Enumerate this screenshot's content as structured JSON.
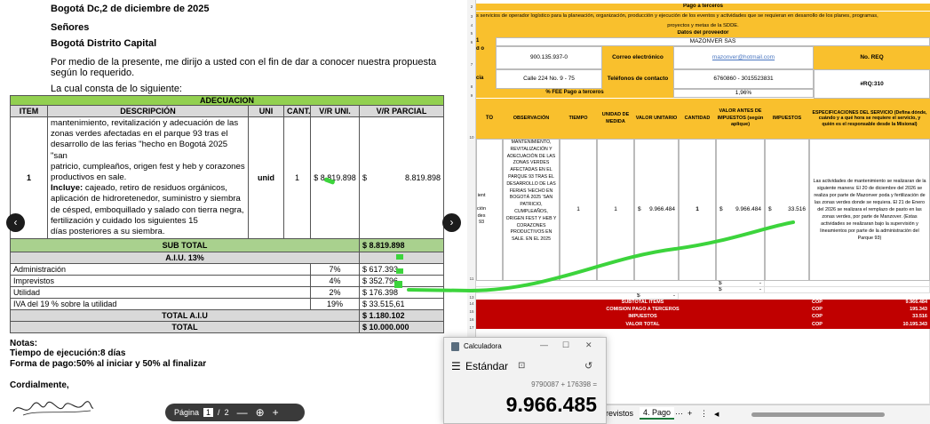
{
  "letter": {
    "date": "Bogotá Dc,2 de diciembre de 2025",
    "greeting": "Señores",
    "recipient": "Bogotá Distrito Capital",
    "intro1": "Por medio de la presente, me dirijo a usted con el fin de dar a conocer nuestra propuesta",
    "intro2": "según lo requerido.",
    "intro3": "La cual consta de lo siguiente:",
    "table_title": "ADECUACION",
    "headers": [
      "ITEM",
      "DESCRIPCIÓN",
      "UNI",
      "CANT.",
      "V/R UNI.",
      "V/R PARCIAL"
    ],
    "item": "1",
    "desc_lines": [
      "mantenimiento, revitalización y adecuación de las",
      "zonas verdes afectadas en el parque 93 tras el",
      "desarrollo de las ferias \"hecho en Bogotá 2025 \"san",
      "patricio, cumpleaños, origen fest y heb y corazones",
      "productivos en sale."
    ],
    "incluye_label": "Incluye:",
    "incluye_lines": [
      " cajeado, retiro de residuos orgánicos,",
      "aplicación de hidroretenedor, suministro y siembra",
      "de césped, emboquillado y salado con tierra negra,",
      "fertilización y cuidado los siguientes 15",
      "días posteriores a su siembra."
    ],
    "uni": "unid",
    "cant": "1",
    "vr_uni": "$ 8.819.898",
    "vr_parcial_sym": "$",
    "vr_parcial": "8.819.898",
    "subtotal_label": "SUB TOTAL",
    "subtotal": "$ 8.819.898",
    "aiu_label": "A.I.U. 13%",
    "aiu_rows": [
      {
        "label": "Administración",
        "pct": "7%",
        "val": "$ 617.393"
      },
      {
        "label": "Imprevistos",
        "pct": "4%",
        "val": "$ 352.796"
      },
      {
        "label": "Utilidad",
        "pct": "2%",
        "val": "$ 176.398"
      },
      {
        "label": "IVA del 19 % sobre la utilidad",
        "pct": "19%",
        "val": "$ 33.515,61"
      }
    ],
    "total_aiu_label": "TOTAL A.I.U",
    "total_aiu": "$ 1.180.102",
    "total_label": "TOTAL",
    "total": "$ 10.000.000",
    "notas": "Notas:",
    "tiempo": "Tiempo de ejecución:8 días",
    "pago": "Forma de pago:50% al iniciar y 50% al finalizar",
    "cordial": "Cordialmente,"
  },
  "pager": {
    "label": "Página",
    "page": "1",
    "sep": "/",
    "total": "2",
    "minus": "—",
    "zoom": "⊕",
    "plus": "+"
  },
  "nav": {
    "prev": "‹",
    "next": "›"
  },
  "sheet": {
    "rows": [
      "2",
      "3",
      "4",
      "5",
      "6",
      "7",
      "8",
      "9",
      "10",
      "11",
      "12",
      "13",
      "14",
      "15",
      "16",
      "17"
    ],
    "title": "Pago a terceros",
    "service_desc": "s servicios de operador logístico para la planeación, organización, producción y ejecución de los eventos y actividades  que se requieran en desarrollo de los planes, programas,",
    "service_desc2": "proyectos y metas de la SDDE.",
    "datos_prov": "Datos del proveedor",
    "r6_num": "1",
    "provider": "MAZONVER SAS",
    "nit_lbl": "d o",
    "nit": "900.135.937-0",
    "correo_lbl": "Correo electrónico",
    "correo": "mazonver@hotmail.com",
    "noreq_lbl": "No. REQ",
    "dir_lbl": "cia",
    "dir": "Calle 224 No. 9 - 75",
    "tel_lbl": "Teléfonos de contacto",
    "tel": "6760860 - 3015523831",
    "req": "#RQ:310",
    "fee_lbl": "% FEE Pago a terceros",
    "fee": "1,96%",
    "hdr_cols": [
      "TO",
      "OBSERVACIÓN",
      "TIEMPO",
      "UNIDAD DE MEDIDA",
      "VALOR UNITARIO",
      "CANTIDAD",
      "VALOR ANTES DE IMPUESTOS (según aplique)",
      "IMPUESTOS"
    ],
    "spec_hdr": "ESPECIFICACIONES DEL SERVICIO (Defina dónde, cuándo y a qué hora se requiere el servicio, y quién es el responsable desde la Misional)",
    "left_frag": "ient\n\nción\ndes\n93",
    "obs": "MANTENIMIENTO, REVITALIZACIÓN Y ADECUACIÓN DE LAS ZONAS VERDES AFECTADAS EN EL PARQUE 93 TRAS EL DESARROLLO DE LAS FERIAS 'HECHO EN BOGOTÁ 2025 'SAN PATRICIO, CUMPLEAÑOS, ORIGEN FEST Y HEB Y CORAZONES PRODUCTIVOS EN SALE. EN EL 2025",
    "tiempo": "1",
    "unidad": "1",
    "valor_sym": "$",
    "valor": "9.966.484",
    "cantidad": "1",
    "antes_sym": "$",
    "antes": "9.966.484",
    "imp_sym": "$",
    "imp": "33.516",
    "spec_text": "Las actividades de mantenimiento se realizaran de la siguiente manera: El 20 de diciembre del 2026 se realiza por parte de Mazonver poda y fertilización de las zonas verdes donde se requiera. El 21 de Enero del 2026 se realizara el remplazo de pasto en las zonas verdes, por parte de Manzover. (Estas actividades se realizaran bajo la supervisión y lineamientos por parte de la administración del Parque 93)",
    "dash_sym": "$",
    "dash": "-",
    "sum_labels": [
      "SUBTOTAL ÍTEMS",
      "COMISIÓN PAGO A TERCEROS",
      "IMPUESTOS",
      "VALOR TOTAL"
    ],
    "cop": "COP",
    "sum_vals": [
      "9.966.484",
      "195.343",
      "33.516",
      "10.195.343"
    ],
    "tab_prev": "Previstos",
    "tab_active": "4. Pago",
    "tab_more": "···",
    "tab_add": "+",
    "tab_menu": "⋮",
    "tab_arrow": "◀"
  },
  "calc": {
    "app": "Calculadora",
    "mode": "Estándar",
    "expr": "9790087 + 176398 =",
    "display": "9.966.485",
    "min": "—",
    "max": "☐",
    "close": "✕",
    "menu": "☰",
    "keep": "⊡",
    "history": "↺"
  },
  "colors": {
    "green_header": "#92d050",
    "green_subtotal": "#a9d18e",
    "orange": "#f9c02d",
    "red": "#c00000",
    "highlight": "#3cd43c"
  }
}
